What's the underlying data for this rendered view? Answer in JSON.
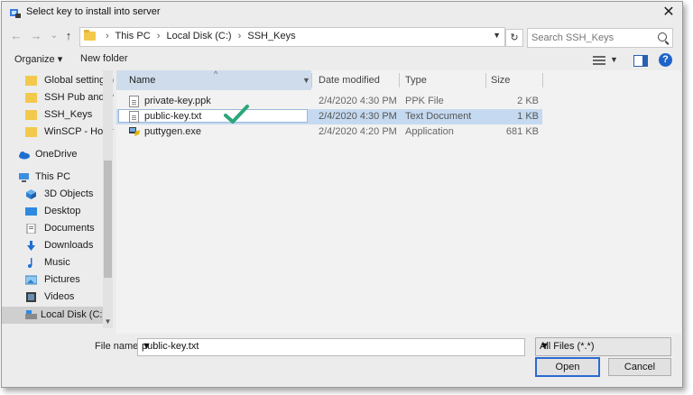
{
  "window": {
    "title": "Select key to install into server",
    "close_glyph": "✕"
  },
  "nav": {
    "back_glyph": "←",
    "forward_glyph": "→",
    "dropdown_glyph": "⌄",
    "up_glyph": "↑"
  },
  "address": {
    "crumbs": [
      "This PC",
      "Local Disk (C:)",
      "SSH_Keys"
    ],
    "separator": "›"
  },
  "search": {
    "placeholder": "Search SSH_Keys"
  },
  "toolbar": {
    "organize_label": "Organize ▾",
    "new_folder_label": "New folder"
  },
  "sidebar": {
    "items": [
      {
        "label": "Global settings (",
        "icon": "folder-icon"
      },
      {
        "label": "SSH Pub and Pri",
        "icon": "folder-icon"
      },
      {
        "label": "SSH_Keys",
        "icon": "folder-icon"
      },
      {
        "label": "WinSCP - How t",
        "icon": "folder-icon"
      },
      {
        "label": "OneDrive",
        "icon": "cloud-icon"
      },
      {
        "label": "This PC",
        "icon": "computer-icon"
      },
      {
        "label": "3D Objects",
        "icon": "cube-icon"
      },
      {
        "label": "Desktop",
        "icon": "desktop-icon"
      },
      {
        "label": "Documents",
        "icon": "documents-icon"
      },
      {
        "label": "Downloads",
        "icon": "download-icon"
      },
      {
        "label": "Music",
        "icon": "music-icon"
      },
      {
        "label": "Pictures",
        "icon": "pictures-icon"
      },
      {
        "label": "Videos",
        "icon": "videos-icon"
      },
      {
        "label": "Local Disk (C:)",
        "icon": "drive-icon"
      }
    ]
  },
  "columns": {
    "name": "Name",
    "date": "Date modified",
    "type": "Type",
    "size": "Size"
  },
  "files": [
    {
      "name": "private-key.ppk",
      "date": "2/4/2020 4:30 PM",
      "type": "PPK File",
      "size": "2 KB",
      "selected": false
    },
    {
      "name": "public-key.txt",
      "date": "2/4/2020 4:30 PM",
      "type": "Text Document",
      "size": "1 KB",
      "selected": true
    },
    {
      "name": "puttygen.exe",
      "date": "2/4/2020 4:20 PM",
      "type": "Application",
      "size": "681 KB",
      "selected": false
    }
  ],
  "footer": {
    "file_name_label": "File name:",
    "file_name_value": "public-key.txt",
    "file_type_value": "All Files (*.*)",
    "open_label": "Open",
    "cancel_label": "Cancel"
  },
  "colors": {
    "selection": "#c5daf0",
    "checkmark": "#2aa77a",
    "accent": "#2a6bd1"
  }
}
